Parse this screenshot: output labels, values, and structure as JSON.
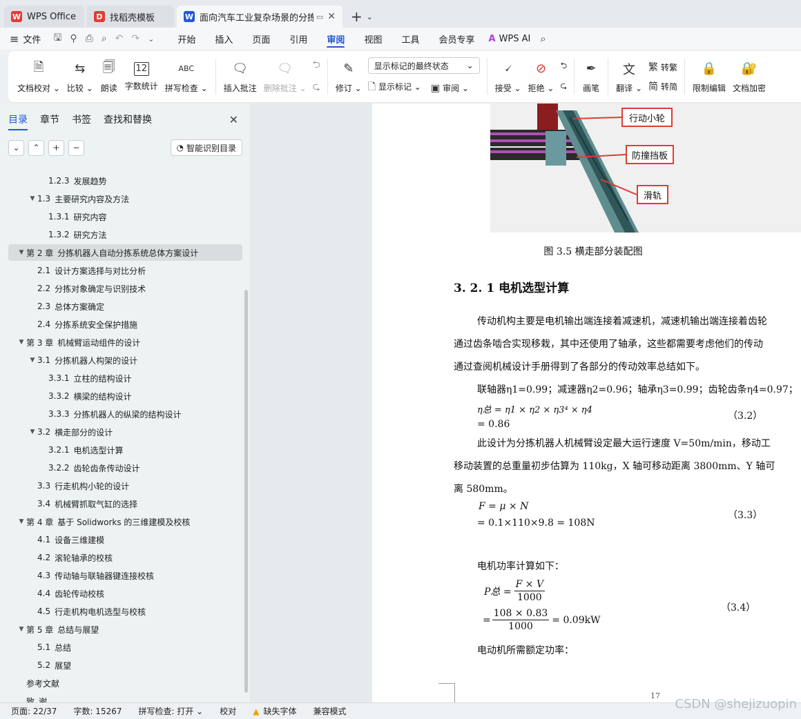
{
  "tabs": [
    {
      "title": "WPS Office",
      "logo": "W",
      "color": "#e53935"
    },
    {
      "title": "找稻壳模板",
      "logo": "D",
      "color": "#e53935"
    },
    {
      "title": "面向汽车工业复杂场景的分拣",
      "logo": "W",
      "color": "#2256d8"
    }
  ],
  "menu": {
    "file": "文件",
    "items": [
      "开始",
      "插入",
      "页面",
      "引用",
      "审阅",
      "视图",
      "工具",
      "会员专享"
    ],
    "active": "审阅",
    "ai": "WPS AI"
  },
  "ribbon": {
    "proofread": "文档校对",
    "compare": "比较",
    "read": "朗读",
    "wordcount": "字数统计",
    "wordcount_icon_text": "12",
    "spellcheck": "拼写检查",
    "spell_icon_text": "ABC",
    "insert_comment": "插入批注",
    "delete_comment": "删除批注",
    "revise": "修订",
    "display_dropdown": "显示标记的最终状态",
    "show_marks": "显示标记",
    "review": "审阅",
    "accept": "接受",
    "reject": "拒绝",
    "pen": "画笔",
    "translate": "翻译",
    "to_traditional": "转繁",
    "to_simplified": "转简",
    "restrict_edit": "限制编辑",
    "encrypt": "文档加密"
  },
  "leftpanel": {
    "tabs": [
      "目录",
      "章节",
      "书签",
      "查找和替换"
    ],
    "smart_toc": "智能识别目录",
    "toc": [
      {
        "level": 3,
        "num": "1.2.3",
        "text": "发展趋势",
        "arrow": ""
      },
      {
        "level": 2,
        "num": "1.3",
        "text": "主要研究内容及方法",
        "arrow": "▼"
      },
      {
        "level": 3,
        "num": "1.3.1",
        "text": "研究内容",
        "arrow": ""
      },
      {
        "level": 3,
        "num": "1.3.2",
        "text": "研究方法",
        "arrow": ""
      },
      {
        "level": 1,
        "num": "第 2 章",
        "text": "分拣机器人自动分拣系统总体方案设计",
        "arrow": "▼",
        "selected": true
      },
      {
        "level": 2,
        "num": "2.1",
        "text": "设计方案选择与对比分析",
        "arrow": ""
      },
      {
        "level": 2,
        "num": "2.2",
        "text": "分拣对象确定与识别技术",
        "arrow": ""
      },
      {
        "level": 2,
        "num": "2.3",
        "text": "总体方案确定",
        "arrow": ""
      },
      {
        "level": 2,
        "num": "2.4",
        "text": "分拣系统安全保护措施",
        "arrow": ""
      },
      {
        "level": 1,
        "num": "第 3 章",
        "text": "机械臂运动组件的设计",
        "arrow": "▼"
      },
      {
        "level": 2,
        "num": "3.1",
        "text": "分拣机器人构架的设计",
        "arrow": "▼"
      },
      {
        "level": 3,
        "num": "3.3.1",
        "text": "立柱的结构设计",
        "arrow": ""
      },
      {
        "level": 3,
        "num": "3.3.2",
        "text": "横梁的结构设计",
        "arrow": ""
      },
      {
        "level": 3,
        "num": "3.3.3",
        "text": "分拣机器人的纵梁的结构设计",
        "arrow": ""
      },
      {
        "level": 2,
        "num": "3.2",
        "text": "横走部分的设计",
        "arrow": "▼"
      },
      {
        "level": 3,
        "num": "3.2.1",
        "text": "电机选型计算",
        "arrow": ""
      },
      {
        "level": 3,
        "num": "3.2.2",
        "text": "齿轮齿条传动设计",
        "arrow": ""
      },
      {
        "level": 2,
        "num": "3.3",
        "text": "行走机构小轮的设计",
        "arrow": ""
      },
      {
        "level": 2,
        "num": "3.4",
        "text": "机械臂抓取气缸的选择",
        "arrow": ""
      },
      {
        "level": 1,
        "num": "第 4 章",
        "text": "基于 Solidworks 的三维建模及校核",
        "arrow": "▼"
      },
      {
        "level": 2,
        "num": "4.1",
        "text": "设备三维建模",
        "arrow": ""
      },
      {
        "level": 2,
        "num": "4.2",
        "text": "滚轮轴承的校核",
        "arrow": ""
      },
      {
        "level": 2,
        "num": "4.3",
        "text": "传动轴与联轴器键连接校核",
        "arrow": ""
      },
      {
        "level": 2,
        "num": "4.4",
        "text": "齿轮传动校核",
        "arrow": ""
      },
      {
        "level": 2,
        "num": "4.5",
        "text": "行走机构电机选型与校核",
        "arrow": ""
      },
      {
        "level": 1,
        "num": "第 5 章",
        "text": "总结与展望",
        "arrow": "▼"
      },
      {
        "level": 2,
        "num": "5.1",
        "text": "总结",
        "arrow": ""
      },
      {
        "level": 2,
        "num": "5.2",
        "text": "展望",
        "arrow": ""
      },
      {
        "level": 1,
        "num": "参考文献",
        "text": "",
        "arrow": ""
      },
      {
        "level": 1,
        "num": "致",
        "text": "谢",
        "arrow": ""
      }
    ]
  },
  "document": {
    "callouts": [
      "行动小轮",
      "防撞挡板",
      "滑轨"
    ],
    "figure_caption": "图 3.5 横走部分装配图",
    "heading": "3. 2. 1 电机选型计算",
    "para1_line1": "传动机构主要是电机输出端连接着减速机，减速机输出端连接着齿轮",
    "para1_line2": "通过齿条啮合实现移栽，其中还使用了轴承，这些都需要考虑他们的传动",
    "para1_line3": "通过查阅机械设计手册得到了各部分的传动效率总结如下。",
    "efficiency_line": "联轴器η1=0.99；减速器η2=0.96；轴承η3=0.99；齿轮齿条η4=0.97；",
    "eq32_line1": "η总 = η1 × η2 × η3⁴ × η4",
    "eq32_line2": "= 0.86",
    "eq32_no": "（3.2）",
    "para2_line1": "此设计为分拣机器人机械臂设定最大运行速度 V=50m/min，移动工",
    "para2_line2": "移动装置的总重量初步估算为 110kg，X 轴可移动距离 3800mm、Y 轴可",
    "para2_line3": "离 580mm。",
    "eq33_line1": "F = μ × N",
    "eq33_line2": "= 0.1×110×9.8 = 108N",
    "eq33_no": "（3.3）",
    "power_intro": "电机功率计算如下：",
    "eq34_lhs": "P总 =",
    "eq34_num1": "F × V",
    "eq34_den1": "1000",
    "eq34_eq": "=",
    "eq34_num2": "108 × 0.83",
    "eq34_den2": "1000",
    "eq34_result": "= 0.09kW",
    "eq34_no": "（3.4）",
    "motor_rated": "电动机所需额定功率：",
    "page_number": "17"
  },
  "status": {
    "page": "页面: 22/37",
    "words": "字数: 15267",
    "spell": "拼写检查: 打开",
    "proof": "校对",
    "missing_font": "缺失字体",
    "compat": "兼容模式"
  },
  "watermark": "CSDN @shejizuopin"
}
